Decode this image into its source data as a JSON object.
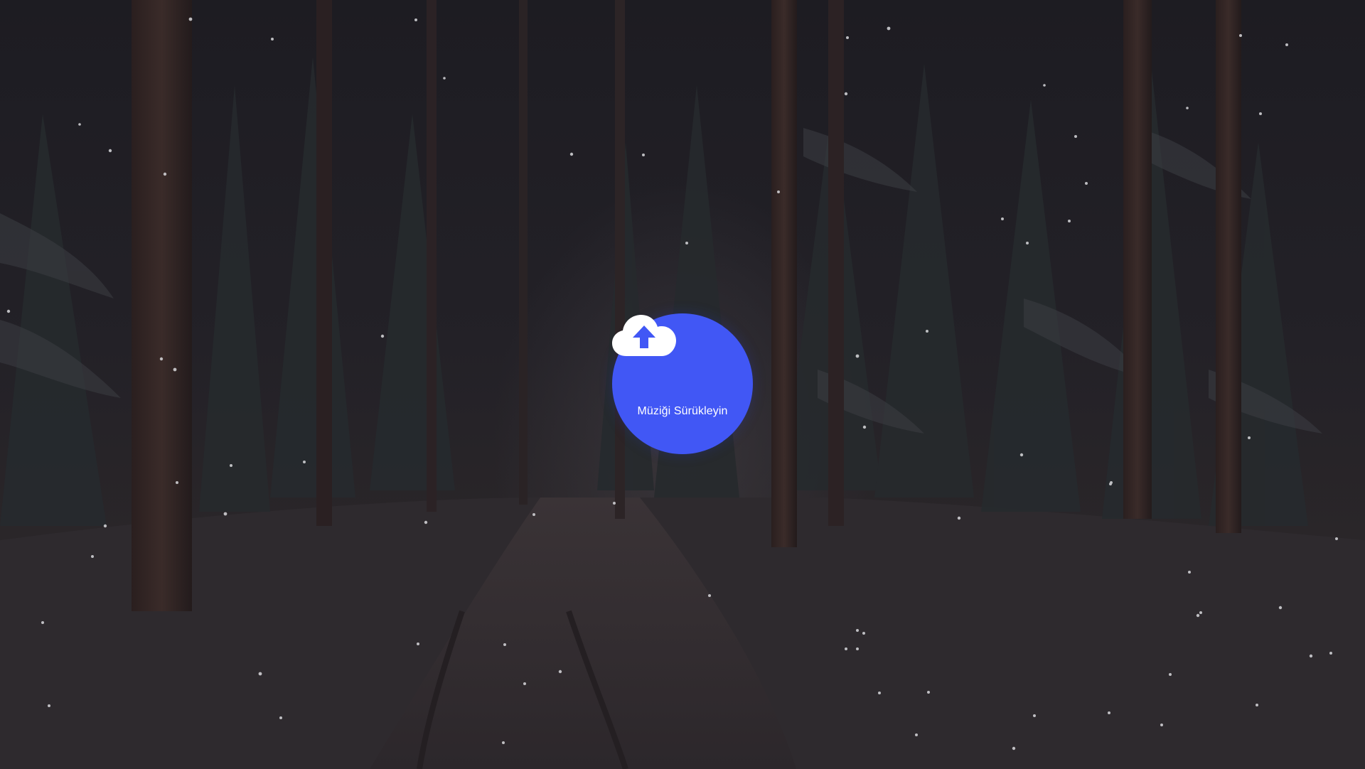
{
  "upload": {
    "label": "Müziği Sürükleyin",
    "icon": "cloud-upload-icon",
    "accent_color": "#4157f5"
  },
  "background": {
    "description_icon": "snowy-forest-background",
    "overlay_color": "#1e1c21"
  }
}
